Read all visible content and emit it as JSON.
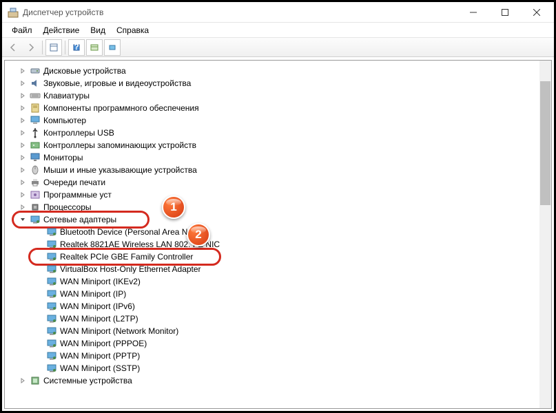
{
  "window": {
    "title": "Диспетчер устройств"
  },
  "menu": [
    "Файл",
    "Действие",
    "Вид",
    "Справка"
  ],
  "badges": [
    "1",
    "2"
  ],
  "tree": [
    {
      "label": "Дисковые устройства",
      "icon": "disk",
      "lvl": 1,
      "arrow": "r"
    },
    {
      "label": "Звуковые, игровые и видеоустройства",
      "icon": "sound",
      "lvl": 1,
      "arrow": "r"
    },
    {
      "label": "Клавиатуры",
      "icon": "keyboard",
      "lvl": 1,
      "arrow": "r"
    },
    {
      "label": "Компоненты программного обеспечения",
      "icon": "sw",
      "lvl": 1,
      "arrow": "r"
    },
    {
      "label": "Компьютер",
      "icon": "computer",
      "lvl": 1,
      "arrow": "r"
    },
    {
      "label": "Контроллеры USB",
      "icon": "usb",
      "lvl": 1,
      "arrow": "r"
    },
    {
      "label": "Контроллеры запоминающих устройств",
      "icon": "storage",
      "lvl": 1,
      "arrow": "r"
    },
    {
      "label": "Мониторы",
      "icon": "monitor",
      "lvl": 1,
      "arrow": "r"
    },
    {
      "label": "Мыши и иные указывающие устройства",
      "icon": "mouse",
      "lvl": 1,
      "arrow": "r"
    },
    {
      "label": "Очереди печати",
      "icon": "printer",
      "lvl": 1,
      "arrow": "r"
    },
    {
      "label": "Программные уст",
      "icon": "swdev",
      "lvl": 1,
      "arrow": "r"
    },
    {
      "label": "Процессоры",
      "icon": "cpu",
      "lvl": 1,
      "arrow": "r"
    },
    {
      "label": "Сетевые адаптеры",
      "icon": "net",
      "lvl": 1,
      "arrow": "d",
      "hi": 1
    },
    {
      "label": "Bluetooth Device (Personal Area N",
      "icon": "net",
      "lvl": 2
    },
    {
      "label": "Realtek 8821AE Wireless LAN 802.              I-E NIC",
      "icon": "net",
      "lvl": 2
    },
    {
      "label": "Realtek PCIe GBE Family Controller",
      "icon": "net",
      "lvl": 2,
      "hi": 2
    },
    {
      "label": "VirtualBox Host-Only Ethernet Adapter",
      "icon": "net",
      "lvl": 2
    },
    {
      "label": "WAN Miniport (IKEv2)",
      "icon": "net",
      "lvl": 2
    },
    {
      "label": "WAN Miniport (IP)",
      "icon": "net",
      "lvl": 2
    },
    {
      "label": "WAN Miniport (IPv6)",
      "icon": "net",
      "lvl": 2
    },
    {
      "label": "WAN Miniport (L2TP)",
      "icon": "net",
      "lvl": 2
    },
    {
      "label": "WAN Miniport (Network Monitor)",
      "icon": "net",
      "lvl": 2
    },
    {
      "label": "WAN Miniport (PPPOE)",
      "icon": "net",
      "lvl": 2
    },
    {
      "label": "WAN Miniport (PPTP)",
      "icon": "net",
      "lvl": 2
    },
    {
      "label": "WAN Miniport (SSTP)",
      "icon": "net",
      "lvl": 2
    },
    {
      "label": "Системные устройства",
      "icon": "system",
      "lvl": 1,
      "arrow": "r"
    }
  ]
}
